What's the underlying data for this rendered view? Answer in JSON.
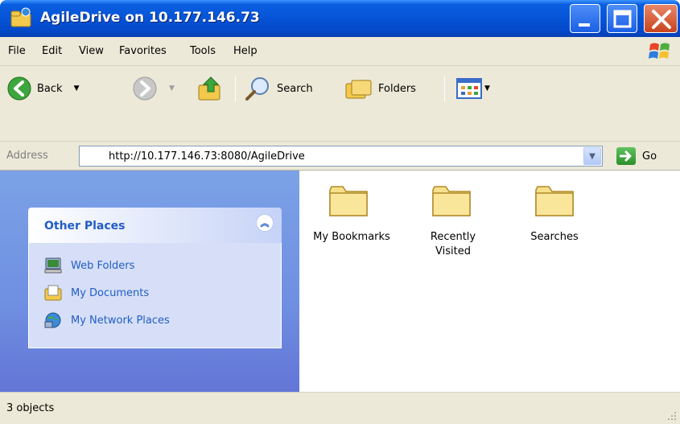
{
  "window": {
    "title": "AgileDrive on 10.177.146.73",
    "icon": "agiledrive-icon"
  },
  "menu": {
    "items": [
      "File",
      "Edit",
      "View",
      "Favorites",
      "Tools",
      "Help"
    ]
  },
  "toolbar": {
    "back_label": "Back",
    "search_label": "Search",
    "folders_label": "Folders"
  },
  "address": {
    "label": "Address",
    "value": "http://10.177.146.73:8080/AgileDrive",
    "go_label": "Go"
  },
  "sidebar": {
    "section_title": "Other Places",
    "links": [
      {
        "label": "Web Folders",
        "icon": "web-folders-icon"
      },
      {
        "label": "My Documents",
        "icon": "my-documents-icon"
      },
      {
        "label": "My Network Places",
        "icon": "network-places-icon"
      }
    ]
  },
  "files": [
    {
      "label": "My Bookmarks",
      "icon": "folder-icon"
    },
    {
      "label": "Recently Visited",
      "icon": "folder-icon"
    },
    {
      "label": "Searches",
      "icon": "folder-icon"
    }
  ],
  "status": {
    "text": "3 objects"
  },
  "colors": {
    "titlebar": "#0653d6",
    "taskpane": "#7ba2e7",
    "link": "#215dc6",
    "chrome": "#ece9d8"
  }
}
